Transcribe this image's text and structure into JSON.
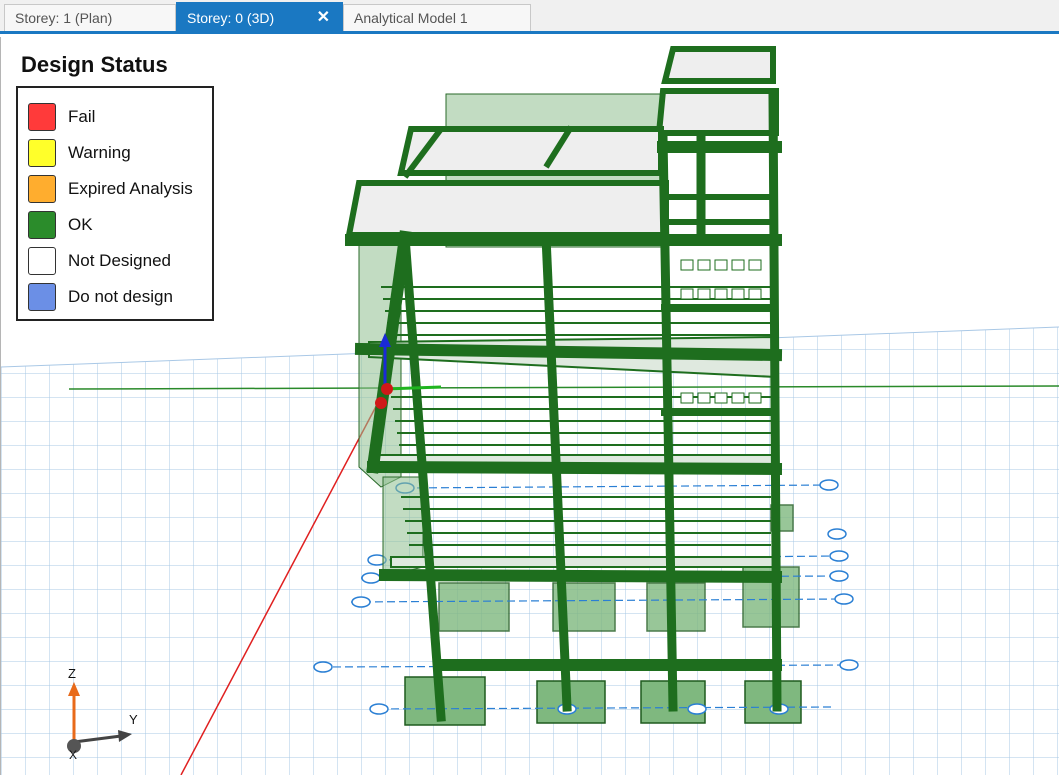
{
  "tabs": [
    {
      "label": "Storey: 1 (Plan)",
      "active": false
    },
    {
      "label": "Storey: 0 (3D)",
      "active": true
    },
    {
      "label": "Analytical Model 1",
      "active": false
    }
  ],
  "close_glyph": "✕",
  "legend": {
    "title": "Design Status",
    "items": [
      {
        "label": "Fail",
        "color": "#ff3a3a"
      },
      {
        "label": "Warning",
        "color": "#ffff2a"
      },
      {
        "label": "Expired Analysis",
        "color": "#ffad2e"
      },
      {
        "label": "OK",
        "color": "#2b8c2b"
      },
      {
        "label": "Not Designed",
        "color": "#ffffff"
      },
      {
        "label": "Do not design",
        "color": "#6b8fe6"
      }
    ]
  },
  "axes": {
    "z": "Z",
    "y": "Y",
    "x": "X"
  },
  "colors": {
    "accent": "#1a78c2",
    "member": "#1e6e1e",
    "panel": "#8fc08f",
    "grid": "#a9c8e6"
  }
}
